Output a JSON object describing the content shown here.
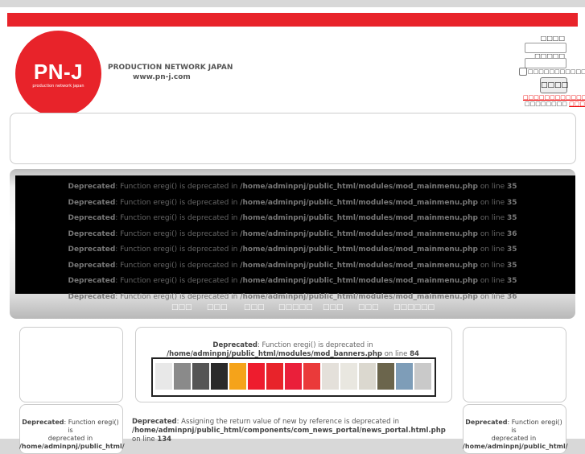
{
  "header": {
    "logo_text": "PN-J",
    "logo_sub": "production network japan",
    "brand_name": "PRODUCTION NETWORK JAPAN",
    "brand_url": "www.pn-j.com"
  },
  "login": {
    "user_label": "□□□□",
    "pass_label": "□□□□□",
    "remember_label": "□□□□□□□□□□□",
    "button_label": "□□□□",
    "forgot_link": "□□□□□□□□□□□□□",
    "register_prefix": "□□□□□□□□",
    "register_link": "□□□□"
  },
  "warnings": {
    "label": "Deprecated",
    "text": ": Function eregi() is deprecated in ",
    "path": "/home/adminpnj/public_html/modules/mod_mainmenu.php",
    "on_line": " on line ",
    "lines": [
      "35",
      "35",
      "35",
      "36",
      "35",
      "35",
      "35",
      "36"
    ]
  },
  "nav": {
    "items": [
      "□□□",
      "□□□",
      "□□□",
      "□□□□□",
      "□□□",
      "□□□",
      "□□□□□□"
    ]
  },
  "center_box": {
    "label": "Deprecated",
    "text": ": Function eregi() is deprecated in",
    "path": "/home/adminpnj/public_html/modules/mod_banners.php",
    "on_line": " on line ",
    "line": "84"
  },
  "swatch_colors": [
    "#e8e8e8",
    "#8a8a8a",
    "#555555",
    "#2a2a2a",
    "#f5a31a",
    "#ee1c2e",
    "#e8232a",
    "#ea1f3a",
    "#ea3a3a",
    "#e4e0da",
    "#e9e7e0",
    "#dbd8cf",
    "#6b654c",
    "#7e9db8",
    "#c9c9c9"
  ],
  "left_box": {
    "label": "Deprecated",
    "text1": ": Function eregi() is",
    "text2": "deprecated in",
    "text3": "/home/adminpnj/public_html/"
  },
  "right_box": {
    "label": "Deprecated",
    "text1": ": Function eregi() is",
    "text2": "deprecated in",
    "text3": "/home/adminpnj/public_html/"
  },
  "bottom_center": {
    "label": "Deprecated",
    "text": ": Assigning the return value of new by reference is deprecated in",
    "path": "/home/adminpnj/public_html/components/com_news_portal/news_portal.html.php",
    "on_line": " on line ",
    "line": "134"
  }
}
